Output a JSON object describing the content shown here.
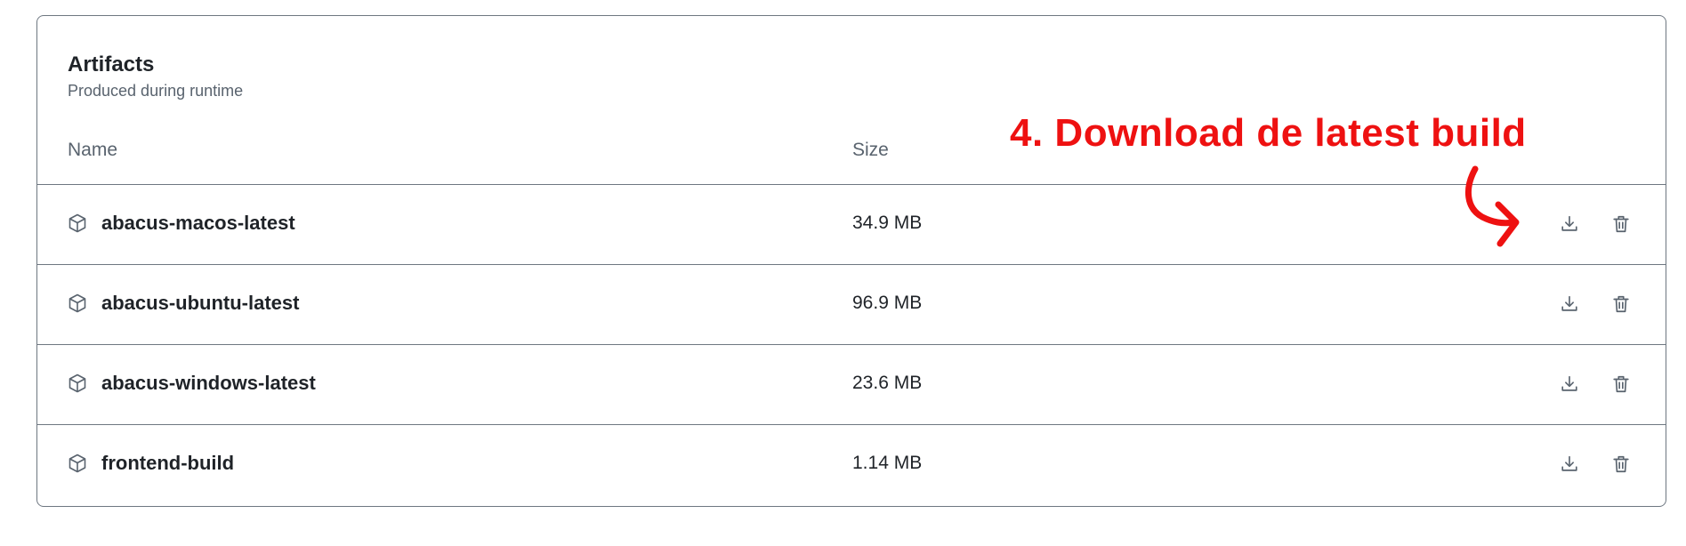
{
  "panel": {
    "title": "Artifacts",
    "subtitle": "Produced during runtime",
    "columns": {
      "name": "Name",
      "size": "Size"
    }
  },
  "artifacts": [
    {
      "name": "abacus-macos-latest",
      "size": "34.9 MB"
    },
    {
      "name": "abacus-ubuntu-latest",
      "size": "96.9 MB"
    },
    {
      "name": "abacus-windows-latest",
      "size": "23.6 MB"
    },
    {
      "name": "frontend-build",
      "size": "1.14 MB"
    }
  ],
  "icons": {
    "row_icon": "package-icon",
    "download": "download-icon",
    "delete": "trash-icon"
  },
  "annotation": {
    "text": "4. Download de latest build",
    "color": "#ee1111"
  }
}
